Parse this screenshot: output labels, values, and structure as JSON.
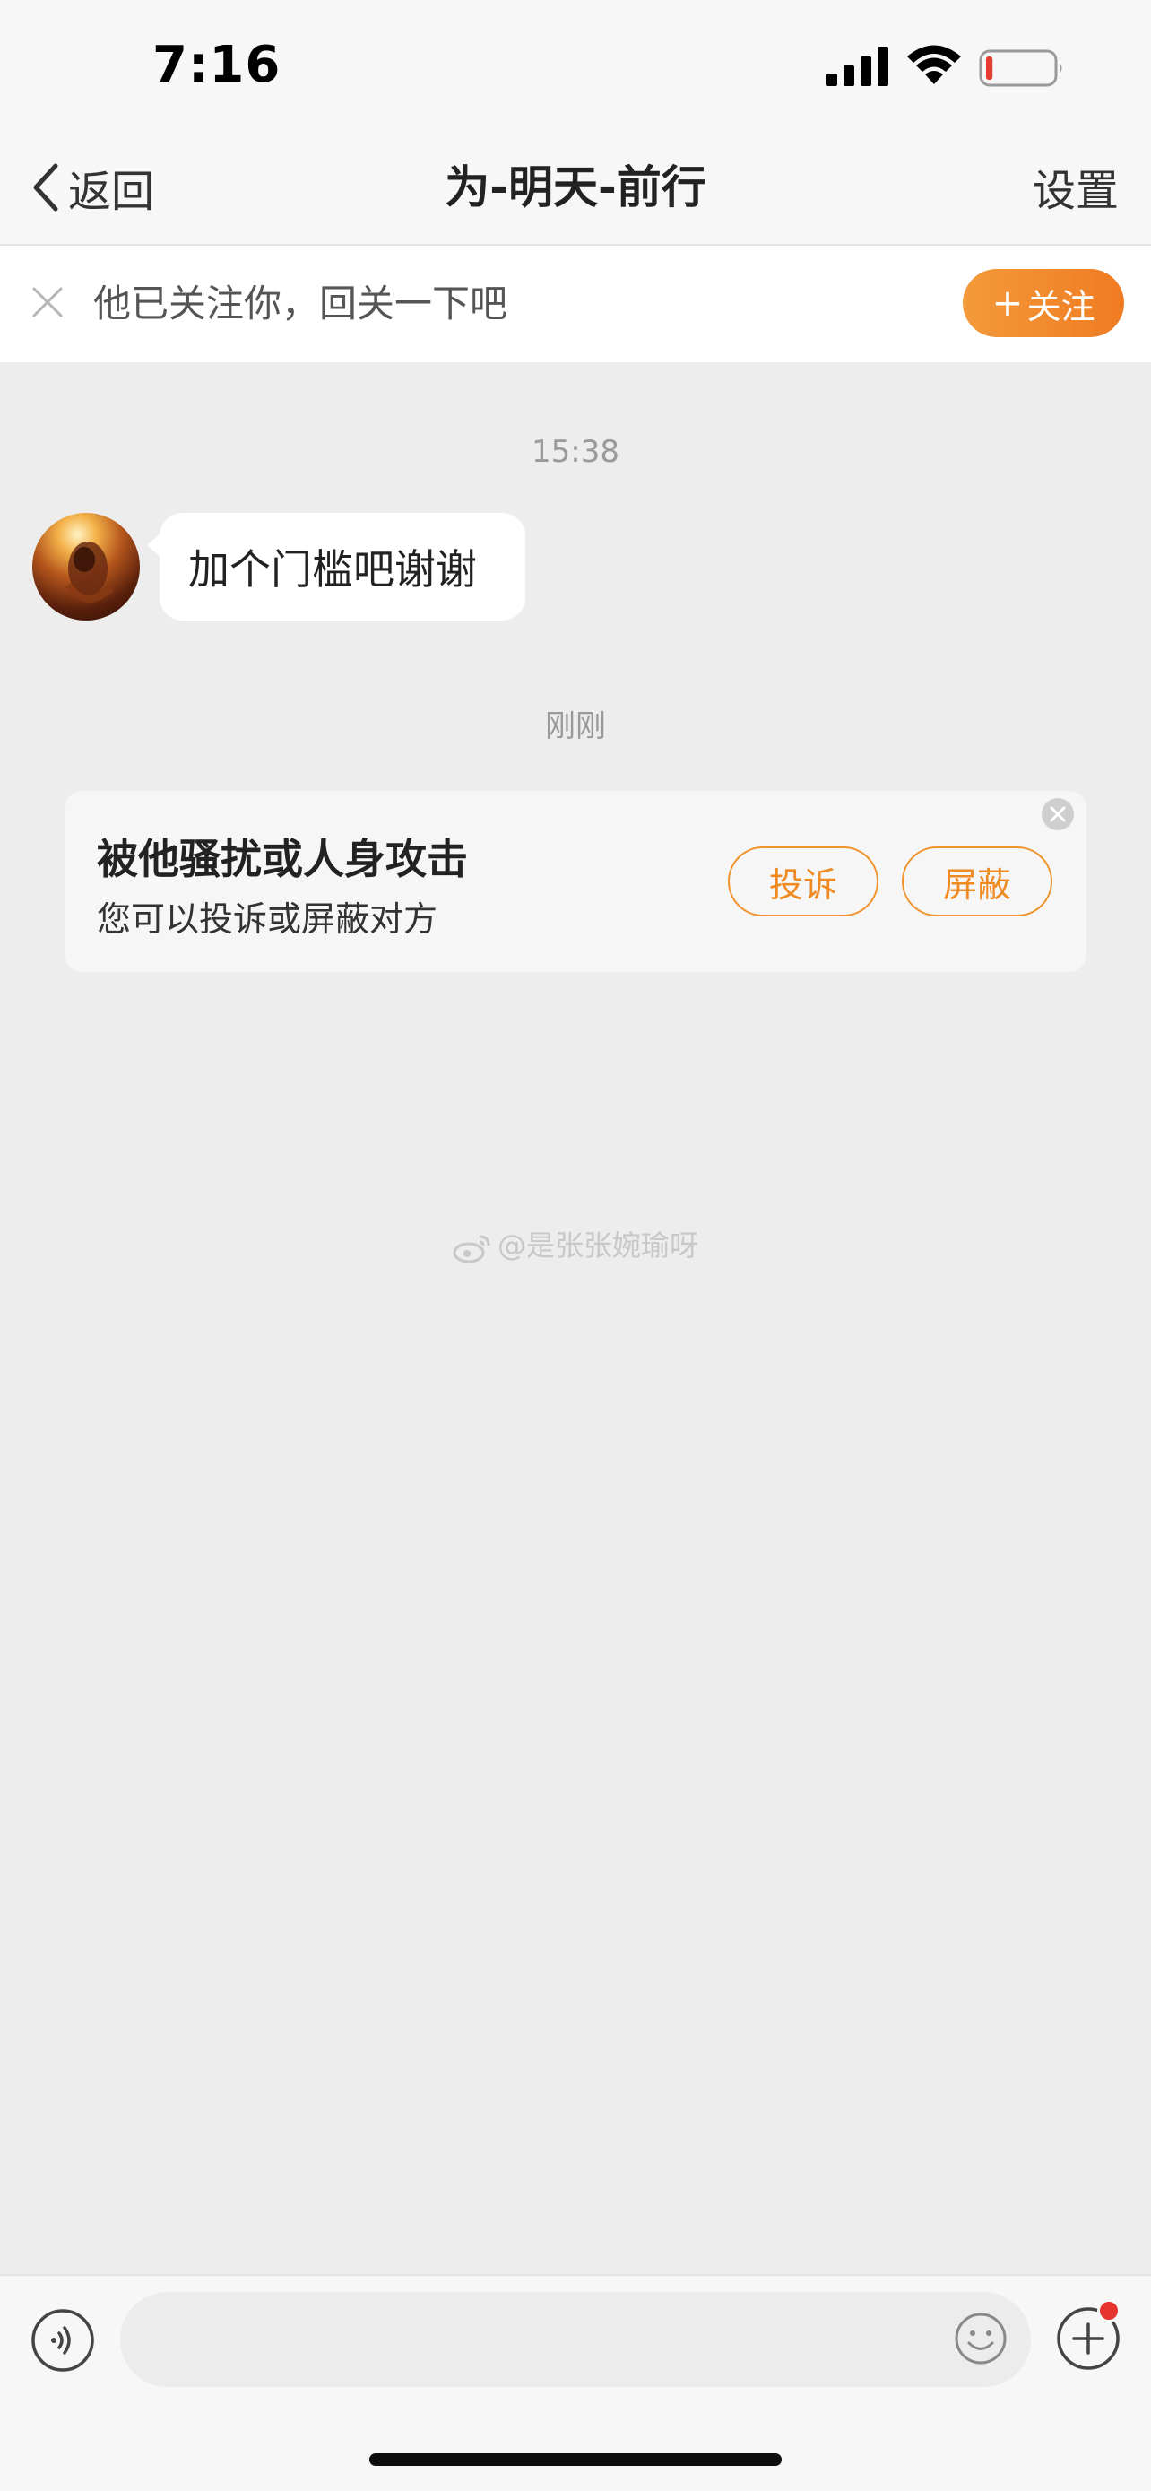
{
  "status_bar": {
    "time": "7:16",
    "battery_level": 0.1,
    "battery_color": "#e53b30"
  },
  "nav": {
    "back_label": "返回",
    "title": "为-明天-前行",
    "settings_label": "设置"
  },
  "follow_banner": {
    "text": "他已关注你，回关一下吧",
    "follow_label": "关注",
    "follow_icon": "plus-icon",
    "accent_color": "#f08428"
  },
  "chat": {
    "timestamps": [
      "15:38",
      "刚刚"
    ],
    "messages": [
      {
        "sender": "other",
        "text": "加个门槛吧谢谢"
      }
    ]
  },
  "harassment_card": {
    "title": "被他骚扰或人身攻击",
    "subtitle": "您可以投诉或屏蔽对方",
    "complain_label": "投诉",
    "block_label": "屏蔽"
  },
  "watermark": "@是张张婉瑜呀",
  "input_bar": {
    "placeholder": "",
    "icons": [
      "voice-icon",
      "emoji-icon",
      "plus-icon"
    ],
    "notification_color": "#e8342e"
  }
}
